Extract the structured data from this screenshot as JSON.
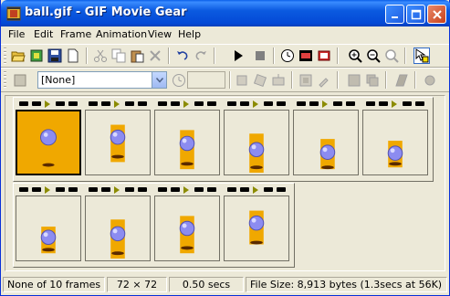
{
  "window": {
    "title": "ball.gif - GIF Movie Gear"
  },
  "menu": {
    "items": [
      "File",
      "Edit",
      "Frame",
      "Animation",
      "View",
      "Help"
    ]
  },
  "toolbar2": {
    "palette_combo_value": "[None]",
    "delay_value": ""
  },
  "frames": {
    "row1_count": 6,
    "row2_count": 4,
    "selected_index": 0
  },
  "status": {
    "selection": "None of 10 frames",
    "dimensions": "72 × 72",
    "delay": "0.50 secs",
    "file_size": "File Size: 8,913 bytes  (1.3secs at 56K)"
  },
  "colors": {
    "titlebar": "#0a5fe8",
    "face": "#ece9d8",
    "frame_bg": "#f0a800",
    "ball": "#8c8cf0"
  }
}
